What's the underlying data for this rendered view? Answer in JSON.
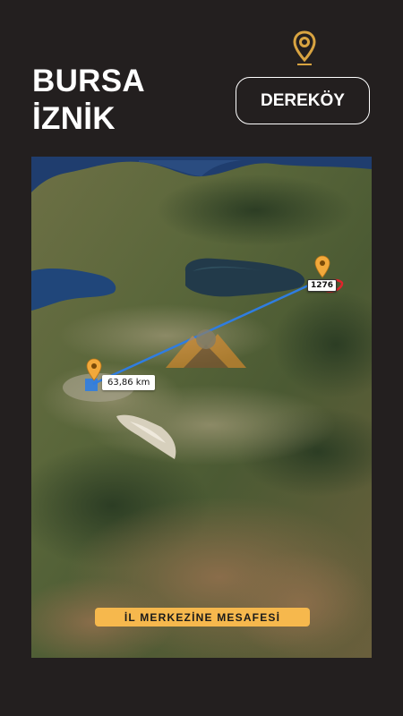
{
  "header": {
    "city": "BURSA",
    "town": "İZNİK",
    "district": "DEREKÖY"
  },
  "map": {
    "distance_label": "63,86 km",
    "parcel_code": "1276",
    "caption": "İL MERKEZİNE MESAFESİ",
    "route_color": "#2f7de1",
    "parcel_color": "#e0242b",
    "pin_color": "#f2a93b"
  },
  "icons": {
    "top_pin": "location-pin-icon",
    "origin_pin": "location-pin-icon",
    "destination_pin": "location-pin-icon",
    "watermark": "mountain-logo-icon"
  }
}
